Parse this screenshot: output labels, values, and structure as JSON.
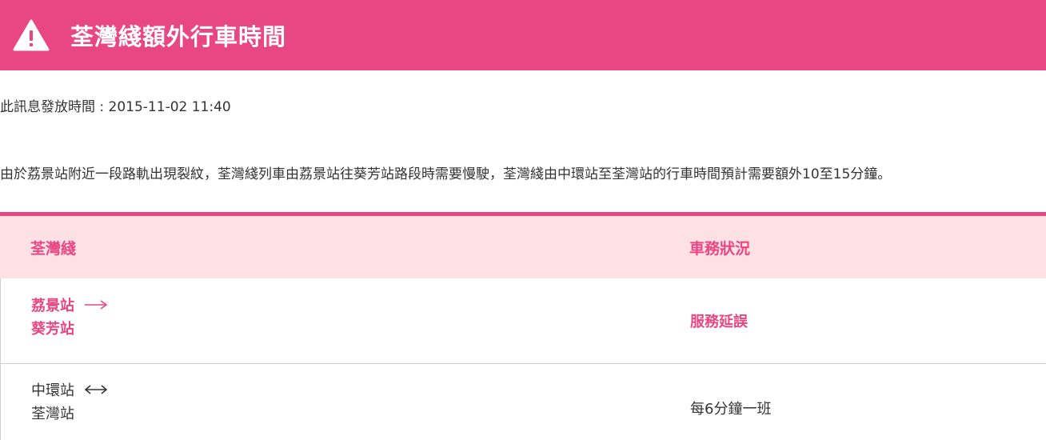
{
  "banner": {
    "title": "荃灣綫額外行車時間",
    "color": "#e94784",
    "icon": "warning-icon"
  },
  "notice": {
    "time_line": "此訊息發放時間 : 2015-11-02 11:40",
    "text": "由於荔景站附近一段路軌出現裂紋，荃灣綫列車由荔景站往葵芳站路段時需要慢駛，荃灣綫由中環站至荃灣站的行車時間預計需要額外10至15分鐘。"
  },
  "table": {
    "headers": {
      "line": "荃灣綫",
      "status": "車務狀況"
    },
    "rows": [
      {
        "from": "荔景站",
        "to": "葵芳站",
        "direction": "one-way",
        "status": "服務延誤"
      },
      {
        "from": "中環站",
        "to": "荃灣站",
        "direction": "two-way",
        "status": "每6分鐘一班"
      }
    ]
  }
}
